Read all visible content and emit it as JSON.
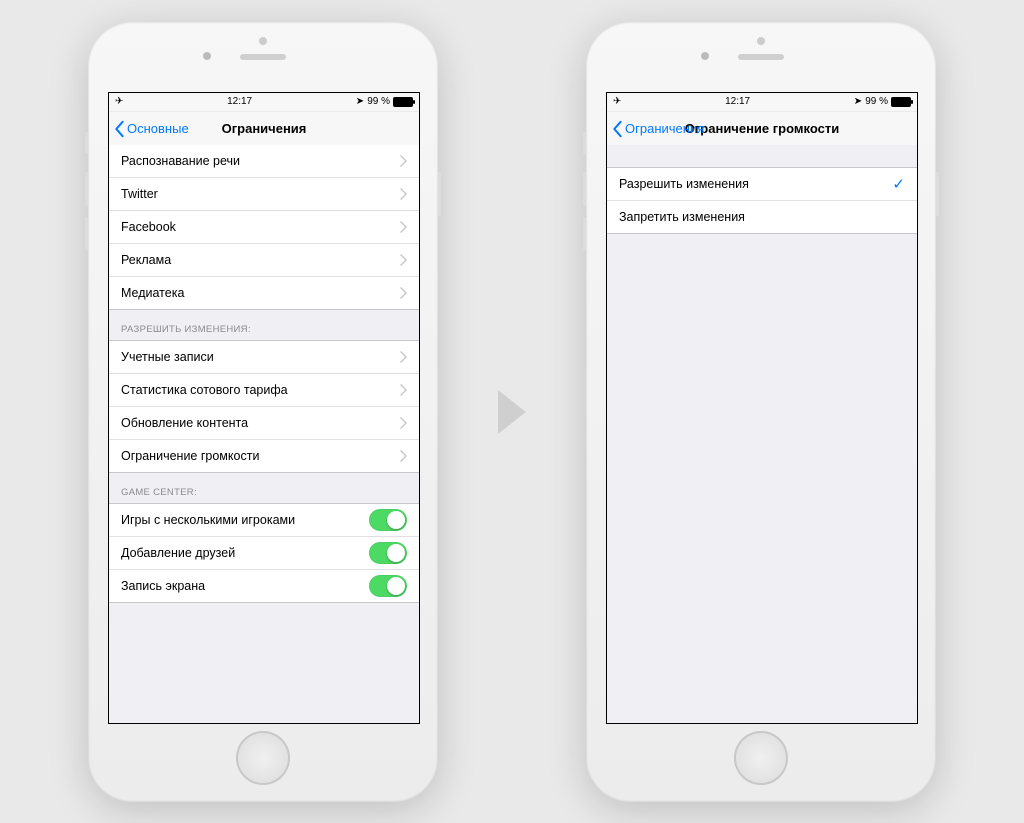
{
  "status": {
    "time": "12:17",
    "batteryText": "99 %",
    "airplane": "✈"
  },
  "phone1": {
    "backLabel": "Основные",
    "title": "Ограничения",
    "clipped": {
      "label": "Распознавание речи"
    },
    "group1": [
      {
        "label": "Twitter"
      },
      {
        "label": "Facebook"
      },
      {
        "label": "Реклама"
      },
      {
        "label": "Медиатека"
      }
    ],
    "header2": "РАЗРЕШИТЬ ИЗМЕНЕНИЯ:",
    "group2": [
      {
        "label": "Учетные записи"
      },
      {
        "label": "Статистика сотового тарифа"
      },
      {
        "label": "Обновление контента"
      },
      {
        "label": "Ограничение громкости"
      }
    ],
    "header3": "GAME CENTER:",
    "group3": [
      {
        "label": "Игры с несколькими игроками",
        "on": true
      },
      {
        "label": "Добавление друзей",
        "on": true
      },
      {
        "label": "Запись экрана",
        "on": true
      }
    ]
  },
  "phone2": {
    "backLabel": "Ограничения",
    "title": "Ограничение громкости",
    "group1": [
      {
        "label": "Разрешить изменения",
        "checked": true
      },
      {
        "label": "Запретить изменения",
        "checked": false
      }
    ]
  }
}
